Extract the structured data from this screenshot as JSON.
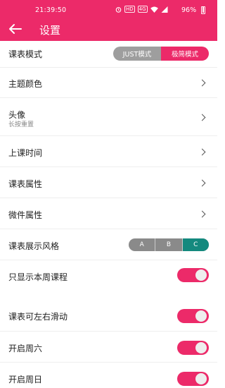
{
  "status_bar": {
    "time": "21:39:50",
    "icons": [
      "alarm-icon",
      "hd-icon",
      "volte-icon",
      "wifi-icon",
      "signal-icon"
    ],
    "battery": "96%"
  },
  "header": {
    "back_icon": "arrow-left-icon",
    "title": "设置",
    "color": "#ec2a69"
  },
  "settings": {
    "mode": {
      "label": "课表模式",
      "options": [
        "JUST模式",
        "极简模式"
      ],
      "selected": "极简模式"
    },
    "theme_color": {
      "label": "主题颜色"
    },
    "avatar": {
      "label": "头像",
      "sublabel": "长按重置"
    },
    "class_time": {
      "label": "上课时间"
    },
    "schedule_props": {
      "label": "课表属性"
    },
    "widget_props": {
      "label": "微件属性"
    },
    "display_style": {
      "label": "课表展示风格",
      "options": [
        "A",
        "B",
        "C"
      ],
      "selected": "C"
    },
    "only_this_week": {
      "label": "只显示本周课程",
      "enabled": true
    },
    "swipe": {
      "label": "课表可左右滑动",
      "enabled": true
    },
    "saturday": {
      "label": "开启周六",
      "enabled": true
    },
    "sunday": {
      "label": "开启周日",
      "enabled": true
    }
  }
}
